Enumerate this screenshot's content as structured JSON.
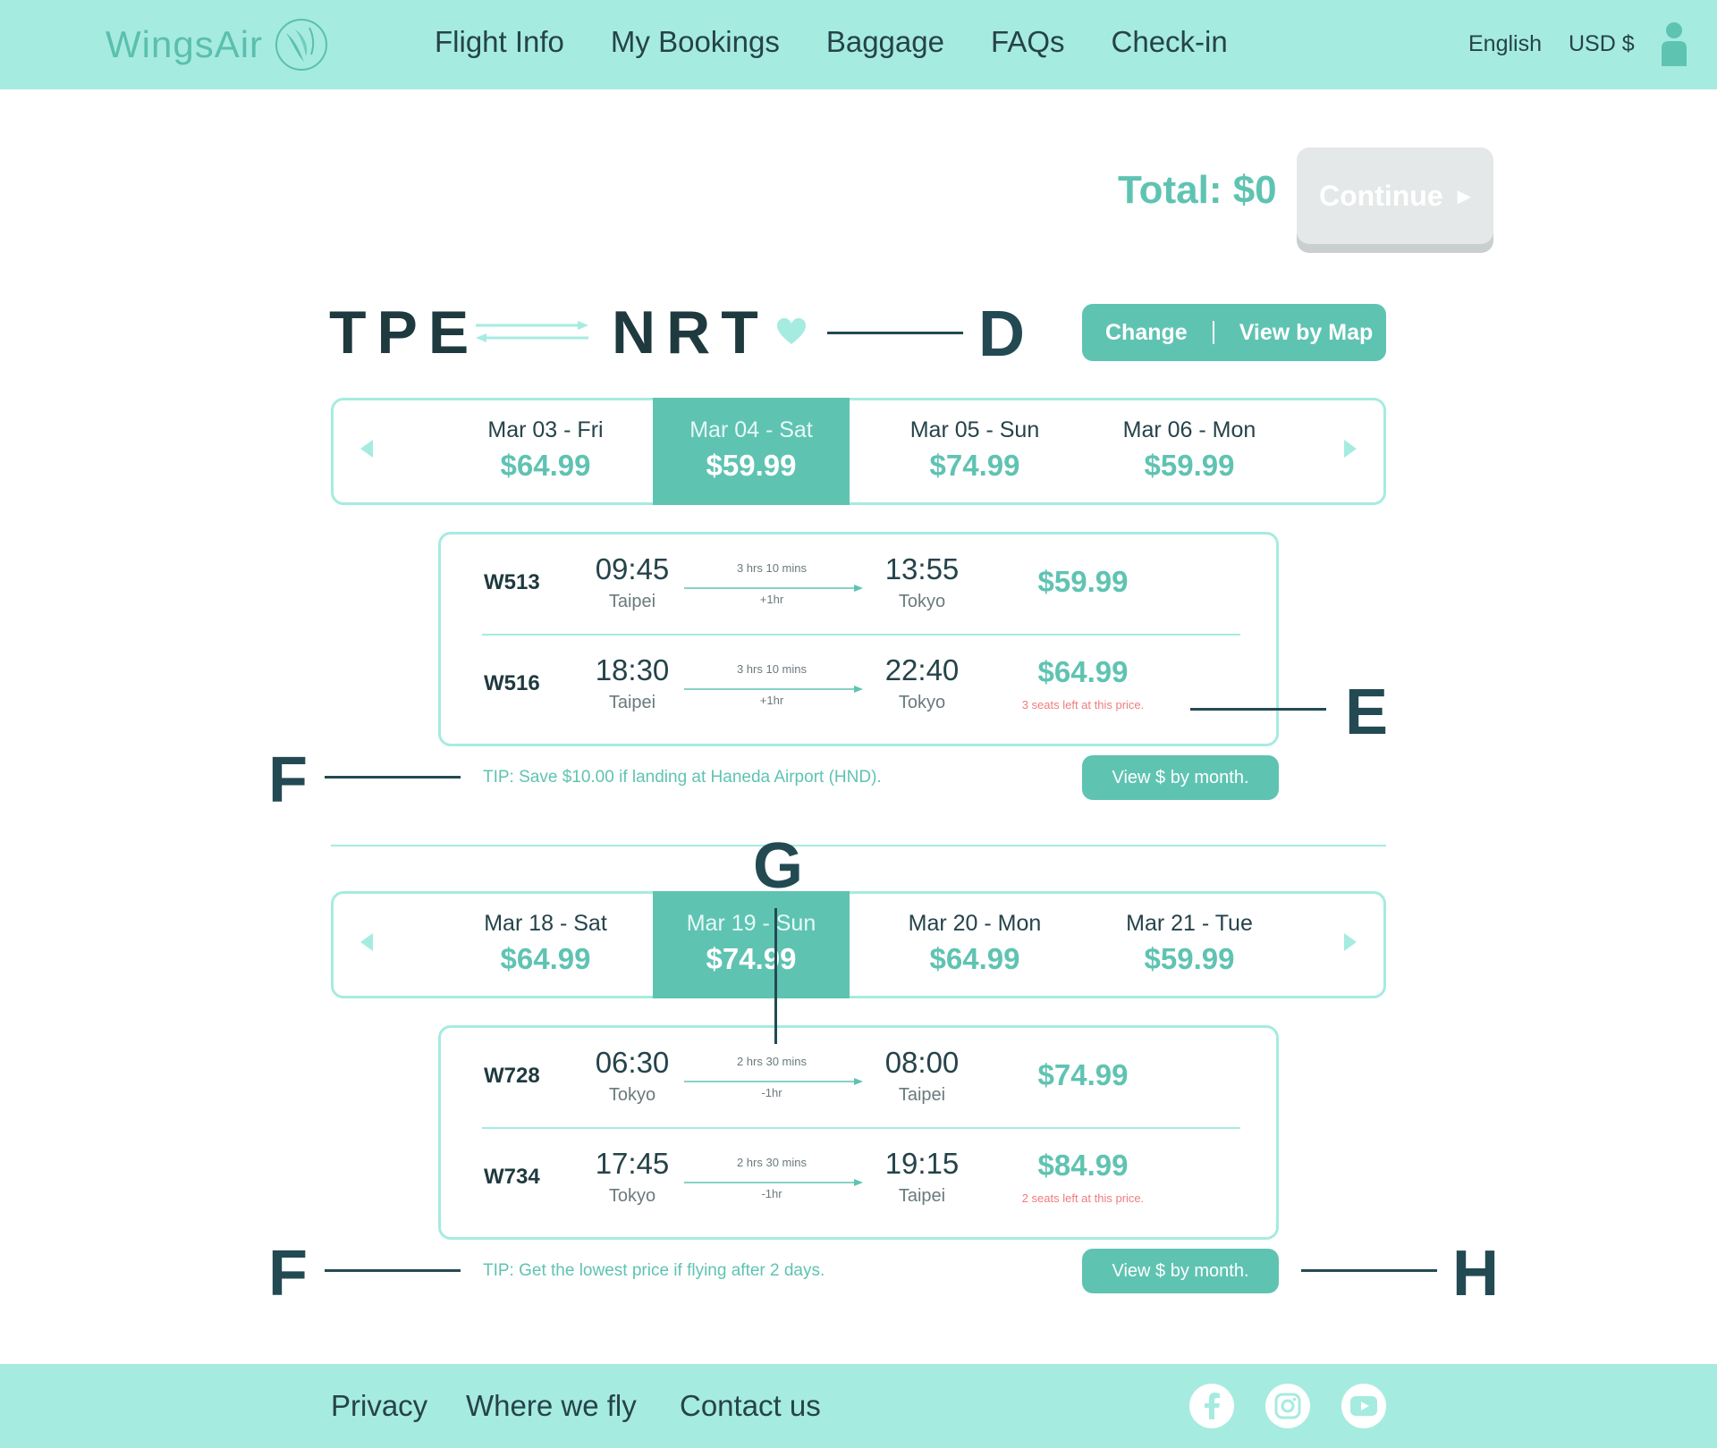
{
  "header": {
    "logo_text": "WingsAir",
    "nav": [
      "Flight Info",
      "My Bookings",
      "Baggage",
      "FAQs",
      "Check-in"
    ],
    "language": "English",
    "currency": "USD $"
  },
  "summary": {
    "total": "Total: $0",
    "continue_label": "Continue"
  },
  "route": {
    "from": "TPE",
    "to": "NRT",
    "change_label": "Change",
    "map_label": "View by Map"
  },
  "outbound": {
    "dates": [
      {
        "date": "Mar 03 - Fri",
        "price": "$64.99"
      },
      {
        "date": "Mar 04 - Sat",
        "price": "$59.99",
        "selected": true
      },
      {
        "date": "Mar 05 - Sun",
        "price": "$74.99"
      },
      {
        "date": "Mar 06 - Mon",
        "price": "$59.99"
      }
    ],
    "flights": [
      {
        "code": "W513",
        "dep_time": "09:45",
        "dep_city": "Taipei",
        "duration": "3 hrs 10 mins",
        "tz_diff": "+1hr",
        "arr_time": "13:55",
        "arr_city": "Tokyo",
        "price": "$59.99",
        "seats": ""
      },
      {
        "code": "W516",
        "dep_time": "18:30",
        "dep_city": "Taipei",
        "duration": "3 hrs 10 mins",
        "tz_diff": "+1hr",
        "arr_time": "22:40",
        "arr_city": "Tokyo",
        "price": "$64.99",
        "seats": "3 seats left at this price."
      }
    ],
    "tip": "TIP: Save $10.00 if landing at Haneda Airport (HND).",
    "month_button": "View $ by month."
  },
  "return": {
    "dates": [
      {
        "date": "Mar 18 - Sat",
        "price": "$64.99"
      },
      {
        "date": "Mar 19 - Sun",
        "price": "$74.99",
        "selected": true
      },
      {
        "date": "Mar 20 - Mon",
        "price": "$64.99"
      },
      {
        "date": "Mar 21 - Tue",
        "price": "$59.99"
      }
    ],
    "flights": [
      {
        "code": "W728",
        "dep_time": "06:30",
        "dep_city": "Tokyo",
        "duration": "2 hrs 30 mins",
        "tz_diff": "-1hr",
        "arr_time": "08:00",
        "arr_city": "Taipei",
        "price": "$74.99",
        "seats": ""
      },
      {
        "code": "W734",
        "dep_time": "17:45",
        "dep_city": "Tokyo",
        "duration": "2 hrs 30 mins",
        "tz_diff": "-1hr",
        "arr_time": "19:15",
        "arr_city": "Taipei",
        "price": "$84.99",
        "seats": "2 seats left at this price."
      }
    ],
    "tip": "TIP: Get the lowest price if flying after 2 days.",
    "month_button": "View $ by month."
  },
  "callouts": {
    "d": "D",
    "e": "E",
    "f": "F",
    "g": "G",
    "h": "H"
  },
  "footer": {
    "links": [
      "Privacy",
      "Where we fly",
      "Contact us"
    ],
    "social_icons": [
      "facebook-icon",
      "instagram-icon",
      "youtube-icon"
    ]
  },
  "colors": {
    "header_bg": "#a6ebe0",
    "accent": "#5fc3b2",
    "warning": "#f07c7c",
    "dark_text": "#1f3a3f"
  }
}
